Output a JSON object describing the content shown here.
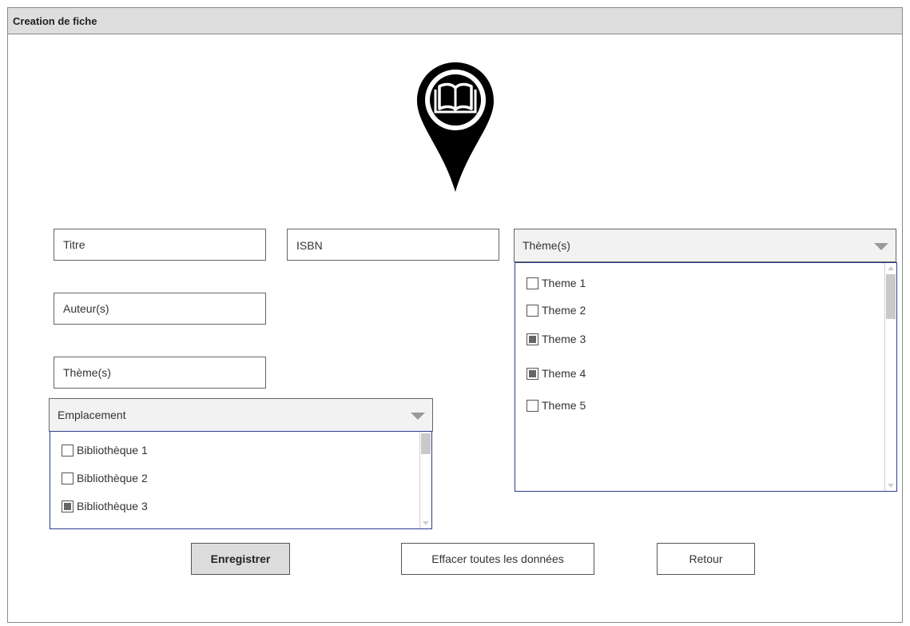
{
  "window": {
    "title": "Creation de fiche"
  },
  "logo": {
    "icon": "book-location-pin-icon"
  },
  "form": {
    "titre": {
      "placeholder": "Titre"
    },
    "isbn": {
      "placeholder": "ISBN"
    },
    "auteurs": {
      "placeholder": "Auteur(s)"
    },
    "themes_field": {
      "placeholder": "Thème(s)"
    }
  },
  "theme_dropdown": {
    "label": "Thème(s)",
    "options": [
      {
        "label": "Theme 1",
        "checked": false
      },
      {
        "label": "Theme 2",
        "checked": false
      },
      {
        "label": "Theme 3",
        "checked": true
      },
      {
        "label": "Theme 4",
        "checked": true
      },
      {
        "label": "Theme 5",
        "checked": false
      }
    ]
  },
  "emplacement_dropdown": {
    "label": "Emplacement",
    "options": [
      {
        "label": "Bibliothèque 1",
        "checked": false
      },
      {
        "label": "Bibliothèque 2",
        "checked": false
      },
      {
        "label": "Bibliothèque 3",
        "checked": true
      }
    ]
  },
  "buttons": {
    "save": "Enregistrer",
    "clear": "Effacer toutes les données",
    "back": "Retour"
  }
}
